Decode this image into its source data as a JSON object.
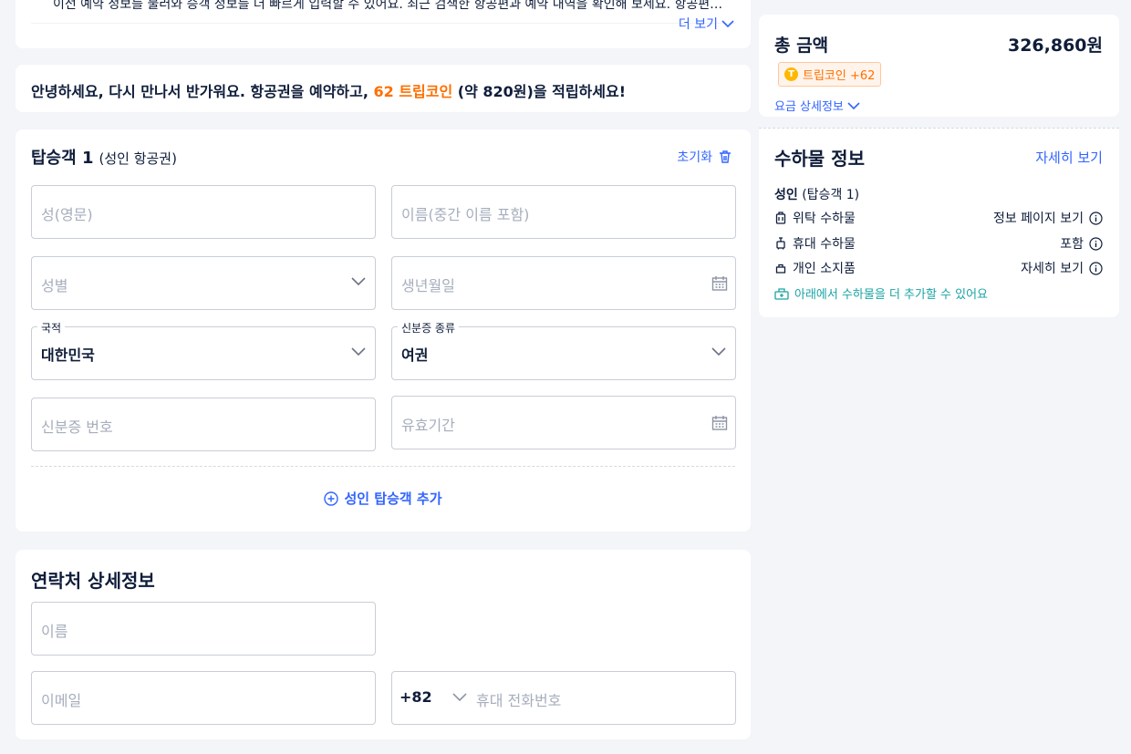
{
  "top_card": {
    "truncated_text": "이전 예약 정보를 불러와 승객 정보를 더 빠르게 입력할 수 있어요. 최근 검색한 항공편과 예약 내역을 확인해 보세요. 항공편…",
    "see_more": "더 보기"
  },
  "welcome": {
    "prefix": "안녕하세요, 다시 만나서 반가워요. 항공권을 예약하고, ",
    "coins": "62 트립코인",
    "suffix": " (약 820원)을 적립하세요!"
  },
  "passenger": {
    "title": "탑승객 1",
    "subtitle": "(성인 항공권)",
    "reset": "초기화",
    "last_name_ph": "성(영문)",
    "first_name_ph": "이름(중간 이름 포함)",
    "gender_ph": "성별",
    "birth_ph": "생년월일",
    "nationality_label": "국적",
    "nationality_value": "대한민국",
    "id_type_label": "신분증 종류",
    "id_type_value": "여권",
    "id_number_ph": "신분증 번호",
    "expiry_ph": "유효기간",
    "add_adult": "성인 탑승객 추가"
  },
  "contact": {
    "title": "연락처 상세정보",
    "name_ph": "이름",
    "email_ph": "이메일",
    "country_code": "+82",
    "phone_ph": "휴대 전화번호"
  },
  "summary": {
    "total_label": "총 금액",
    "total_amount": "326,860원",
    "coin_badge": "트립코인 +62",
    "fare_details": "요금 상세정보"
  },
  "baggage": {
    "title": "수하물 정보",
    "details_link": "자세히 보기",
    "passenger_type": "성인",
    "passenger_ref": "(탑승객 1)",
    "items": [
      {
        "label": "위탁 수하물",
        "value": "정보 페이지 보기",
        "icon": "checked-bag-icon"
      },
      {
        "label": "휴대 수하물",
        "value": "포함",
        "icon": "carry-on-icon"
      },
      {
        "label": "개인 소지품",
        "value": "자세히 보기",
        "icon": "personal-item-icon"
      }
    ],
    "add_note": "아래에서 수하물을 더 추가할 수 있어요"
  },
  "colors": {
    "accent": "#3264ff",
    "coin_orange": "#ff6f00",
    "teal": "#1aa3a3",
    "text": "#0f1d3a",
    "placeholder": "#a6adbc",
    "page_bg": "#f3f5f9"
  }
}
